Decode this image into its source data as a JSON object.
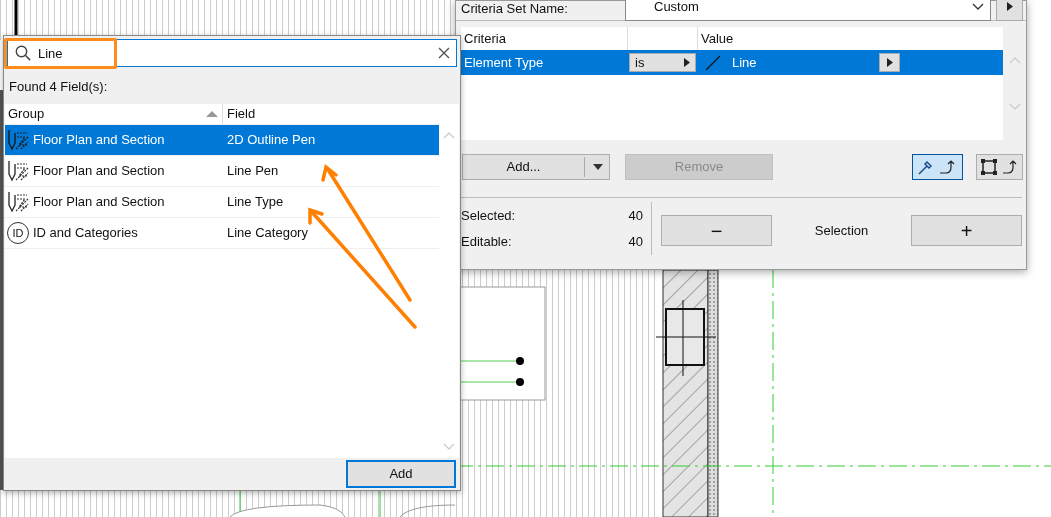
{
  "criteria_dialog": {
    "set_name_label": "Criteria Set Name:",
    "set_name_value": "Custom",
    "columns": [
      "Criteria",
      "",
      "Value"
    ],
    "rows": [
      {
        "criteria": "Element Type",
        "operator": "is",
        "value": "Line",
        "selected": true
      }
    ],
    "add_button": "Add...",
    "remove_button": {
      "label": "Remove",
      "disabled": true
    },
    "pick_toggle": {
      "selected": true
    },
    "marquee_toggle": {
      "selected": false
    },
    "stats": [
      {
        "label": "Selected:",
        "value": "40"
      },
      {
        "label": "Editable:",
        "value": "40"
      }
    ],
    "selection_minus": "−",
    "selection_label": "Selection",
    "selection_plus": "+"
  },
  "field_search": {
    "query": "Line",
    "found_label": "Found 4 Field(s):",
    "columns": [
      "Group",
      "Field"
    ],
    "rows": [
      {
        "kind": "floor_plan",
        "group": "Floor Plan and Section",
        "field": "2D Outline Pen",
        "selected": true
      },
      {
        "kind": "floor_plan",
        "group": "Floor Plan and Section",
        "field": "Line Pen",
        "selected": false
      },
      {
        "kind": "floor_plan",
        "group": "Floor Plan and Section",
        "field": "Line Type",
        "selected": false
      },
      {
        "kind": "id",
        "icon_label": "ID",
        "group": "ID and Categories",
        "field": "Line Category",
        "selected": false
      }
    ],
    "add_button": "Add"
  }
}
